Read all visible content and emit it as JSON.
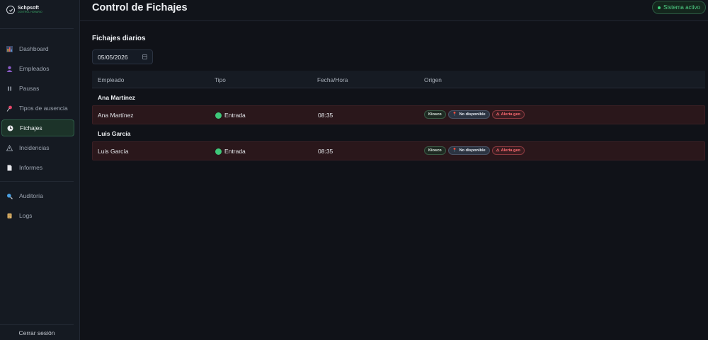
{
  "brand": {
    "name": "Schpsoft",
    "subtitle": "CONTROL HORARIO"
  },
  "sidebar": {
    "items": [
      {
        "label": "Dashboard",
        "icon": "chart-icon"
      },
      {
        "label": "Empleados",
        "icon": "user-icon"
      },
      {
        "label": "Pausas",
        "icon": "pause-icon"
      },
      {
        "label": "Tipos de ausencia",
        "icon": "pin-icon"
      },
      {
        "label": "Fichajes",
        "icon": "clock-icon",
        "active": true
      },
      {
        "label": "Incidencias",
        "icon": "warning-icon"
      },
      {
        "label": "Informes",
        "icon": "document-icon"
      },
      {
        "label": "Auditoría",
        "icon": "search-icon"
      },
      {
        "label": "Logs",
        "icon": "scroll-icon"
      }
    ],
    "logout_label": "Cerrar sesión"
  },
  "header": {
    "title": "Control de Fichajes",
    "status": "Sistema activo",
    "status_color": "#4fcf85"
  },
  "main": {
    "section_title": "Fichajes diarios",
    "date_value": "05/05/2026",
    "columns": [
      "Empleado",
      "Tipo",
      "Fecha/Hora",
      "Origen"
    ],
    "groups": [
      {
        "name": "Ana Martínez",
        "rows": [
          {
            "employee": "Ana Martínez",
            "tipo": "Entrada",
            "hora": "08:35",
            "badges": {
              "origen": "Kiosco",
              "location": "No disponible",
              "alert": "Alerta geo"
            }
          }
        ]
      },
      {
        "name": "Luis García",
        "rows": [
          {
            "employee": "Luis García",
            "tipo": "Entrada",
            "hora": "08:35",
            "badges": {
              "origen": "Kiosco",
              "location": "No disponible",
              "alert": "Alerta geo"
            }
          }
        ]
      }
    ]
  },
  "colors": {
    "accent": "#3ec779",
    "alert_row": "#2a171b",
    "alert_text": "#ff6b72"
  }
}
